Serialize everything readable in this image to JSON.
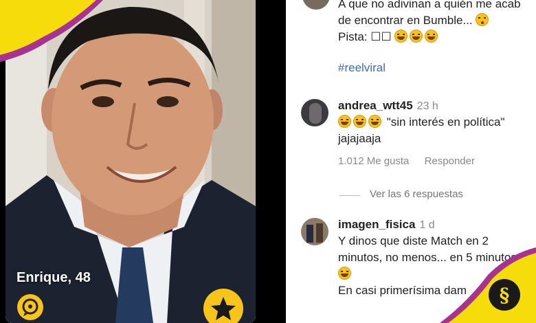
{
  "profile_card": {
    "name_age": "Enrique, 48"
  },
  "post": {
    "caption_line1": "A que no adivinan a quién me acab",
    "caption_line2": "de encontrar en Bumble...",
    "caption_line3": "Pista: ☐☐",
    "hashtag": "#reelviral"
  },
  "comments": [
    {
      "username": "andrea_wtt45",
      "time": "23 h",
      "text_line1": "\"sin interés en política\"",
      "text_line2": "jajajaaja",
      "likes": "1.012 Me gusta",
      "reply": "Responder"
    },
    {
      "username": "imagen_fisica",
      "time": "1 d",
      "text_line1": "Y dinos que diste Match en 2",
      "text_line2": "minutos, no menos... en 5 minutos",
      "text_line4": "En casi primerísima dam"
    }
  ],
  "view_replies": "Ver las 6 respuestas",
  "icons": [
    "chat-bubble-icon",
    "star-icon",
    "brand-s-logo"
  ],
  "colors": {
    "accent_yellow": "#f7dc0c",
    "accent_purple": "#a8328f",
    "hashtag_blue": "#3a6fb0"
  }
}
